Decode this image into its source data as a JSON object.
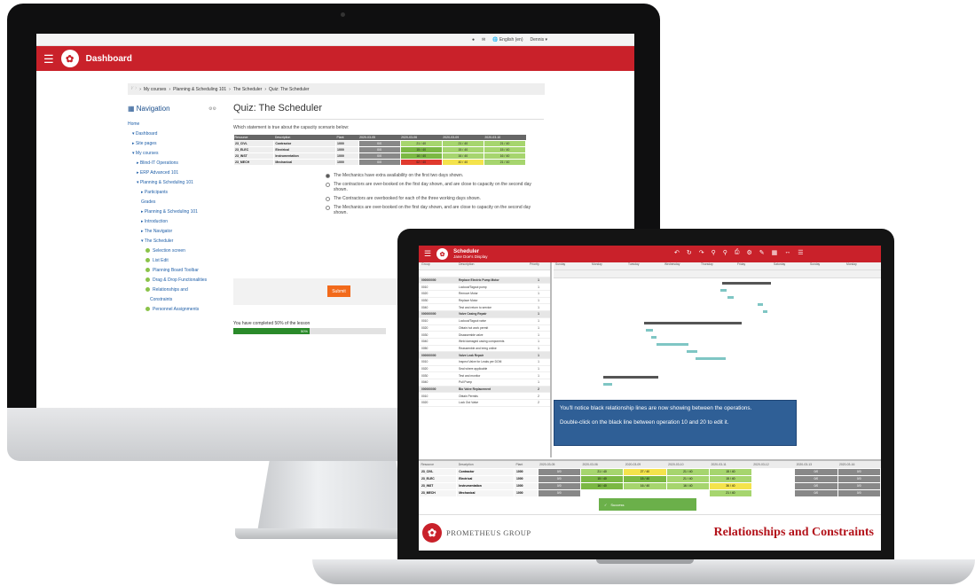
{
  "desktop": {
    "topbar": {
      "language": "English (en)",
      "user": "Dennis"
    },
    "header": {
      "title": "Dashboard"
    },
    "breadcrumb": [
      "My courses",
      "Planning & Scheduling 101",
      "The Scheduler",
      "Quiz: The Scheduler"
    ],
    "nav": {
      "title": "Navigation",
      "items": [
        {
          "label": "Home",
          "indent": 0
        },
        {
          "label": "▾ Dashboard",
          "indent": 1
        },
        {
          "label": "▸ Site pages",
          "indent": 1
        },
        {
          "label": "▾ My courses",
          "indent": 1
        },
        {
          "label": "▸ Blind-IT Operations",
          "indent": 2
        },
        {
          "label": "▸ ERP Advanced 101",
          "indent": 2
        },
        {
          "label": "▾ Planning & Scheduling 101",
          "indent": 2
        },
        {
          "label": "▸ Participants",
          "indent": 3
        },
        {
          "label": "Grades",
          "indent": 3
        },
        {
          "label": "▸ Planning & Scheduling 101",
          "indent": 3
        },
        {
          "label": "▸ Introduction",
          "indent": 3
        },
        {
          "label": "▸ The Navigator",
          "indent": 3
        },
        {
          "label": "▾ The Scheduler",
          "indent": 3
        },
        {
          "label": "Selection screen",
          "indent": 4,
          "dot": true
        },
        {
          "label": "List Edit",
          "indent": 4,
          "dot": true
        },
        {
          "label": "Planning Board Toolbar",
          "indent": 4,
          "dot": true
        },
        {
          "label": "Drag & Drop Functionalities",
          "indent": 4,
          "dot": true
        },
        {
          "label": "Relationships and",
          "indent": 4,
          "dot": true
        },
        {
          "label": "Constraints",
          "indent": 5
        },
        {
          "label": "Personnel Assignments",
          "indent": 4,
          "dot": true
        }
      ]
    },
    "quiz": {
      "title": "Quiz: The Scheduler",
      "question": "Which statement is true about the capacity scenario below:",
      "table_headers": [
        "Resource",
        "Description",
        "Plant",
        "2020-03-05",
        "2020-03-06",
        "2020-03-09",
        "2020-03-10"
      ],
      "table_rows": [
        {
          "res": "23_CIVL",
          "desc": "Contractor",
          "plant": "1000",
          "cells": [
            [
              "0/0",
              "grey"
            ],
            [
              "21 / 40",
              "green"
            ],
            [
              "21 / 40",
              "green"
            ],
            [
              "21 / 40",
              "green"
            ]
          ]
        },
        {
          "res": "23_ELEC",
          "desc": "Electrical",
          "plant": "1000",
          "cells": [
            [
              "0/0",
              "grey"
            ],
            [
              "15 / 40",
              "dkgreen"
            ],
            [
              "15 / 40",
              "green"
            ],
            [
              "15 / 40",
              "green"
            ]
          ]
        },
        {
          "res": "23_INST",
          "desc": "Instrumentation",
          "plant": "1000",
          "cells": [
            [
              "0/0",
              "grey"
            ],
            [
              "16 / 40",
              "dkgreen"
            ],
            [
              "16 / 40",
              "green"
            ],
            [
              "16 / 40",
              "green"
            ]
          ]
        },
        {
          "res": "23_MECH",
          "desc": "Mechanical",
          "plant": "1000",
          "cells": [
            [
              "0/0",
              "grey"
            ],
            [
              "62 / 40",
              "red"
            ],
            [
              "40 / 40",
              "yellow"
            ],
            [
              "21 / 40",
              "green"
            ]
          ]
        }
      ],
      "answers": [
        {
          "text": "The Mechanics have extra availability on the first two days shown.",
          "selected": true
        },
        {
          "text": "The contractors are over-booked on the first day shown, and are close to capacity on the second day shown.",
          "selected": false
        },
        {
          "text": "The Contractors are overbooked for each of the three working days shown.",
          "selected": false
        },
        {
          "text": "The Mechanics are over-booked on the first day shown, and are close to capacity on the second day shown.",
          "selected": false
        }
      ],
      "submit_label": "Submit",
      "completion_text": "You have completed 50% of the lesson",
      "progress_label": "50%",
      "progress_fraction": 0.5
    }
  },
  "laptop": {
    "header": {
      "title": "Scheduler",
      "subtitle": "Jane Doe's Display"
    },
    "left_headers": [
      "Group",
      "Description",
      "Priority"
    ],
    "rows": [
      {
        "c1": "",
        "c2": "",
        "c3": "",
        "grp": false
      },
      {
        "c1": "000000000",
        "c2": "Replace Electric Pump Motor",
        "c3": "1",
        "grp": true
      },
      {
        "c1": "0010",
        "c2": "Lockout/Tagout pump",
        "c3": "1",
        "grp": false
      },
      {
        "c1": "0020",
        "c2": "Remove Motor",
        "c3": "1",
        "grp": false
      },
      {
        "c1": "0030",
        "c2": "Replace Motor",
        "c3": "1",
        "grp": false
      },
      {
        "c1": "0040",
        "c2": "Test and return to service",
        "c3": "1",
        "grp": false
      },
      {
        "c1": "000000000",
        "c2": "Valve Casing Repair",
        "c3": "1",
        "grp": true
      },
      {
        "c1": "0010",
        "c2": "Lockout/Tagout valve",
        "c3": "1",
        "grp": false
      },
      {
        "c1": "0020",
        "c2": "Obtain hot work permit",
        "c3": "1",
        "grp": false
      },
      {
        "c1": "0030",
        "c2": "Disassemble valve",
        "c3": "1",
        "grp": false
      },
      {
        "c1": "0040",
        "c2": "Weld damaged casing components",
        "c3": "1",
        "grp": false
      },
      {
        "c1": "0050",
        "c2": "Reassemble and bring online",
        "c3": "1",
        "grp": false
      },
      {
        "c1": "000000000",
        "c2": "Valve Leak Repair",
        "c3": "1",
        "grp": true
      },
      {
        "c1": "0010",
        "c2": "Inspect Valve for Leaks per DOM",
        "c3": "1",
        "grp": false
      },
      {
        "c1": "0020",
        "c2": "Seal where applicable",
        "c3": "1",
        "grp": false
      },
      {
        "c1": "0030",
        "c2": "Test and monitor",
        "c3": "1",
        "grp": false
      },
      {
        "c1": "0040",
        "c2": "Pull Pump",
        "c3": "1",
        "grp": false
      },
      {
        "c1": "000000000",
        "c2": "Bio Valve Replacement",
        "c3": "2",
        "grp": true
      },
      {
        "c1": "0010",
        "c2": "Obtain Permits",
        "c3": "2",
        "grp": false
      },
      {
        "c1": "0020",
        "c2": "Lock Out Valve",
        "c3": "2",
        "grp": false
      }
    ],
    "days": [
      "Sunday",
      "Monday",
      "Tuesday",
      "Wednesday",
      "Thursday",
      "Friday",
      "Saturday",
      "Sunday",
      "Monday"
    ],
    "tooltip": {
      "line1": "You'll notice black relationship lines are now showing between the operations.",
      "line2": "Double-click on the black line between operation 10 and 20 to edit it."
    },
    "bottom_headers": [
      "Resource",
      "Description",
      "Plant",
      "2020-03-05",
      "2020-03-06",
      "2020-03-09",
      "2020-03-10",
      "2020-03-11",
      "2020-03-12",
      "2020-03-13",
      "2020-03-16"
    ],
    "bottom_rows": [
      {
        "res": "23_CIVL",
        "desc": "Contractor",
        "plant": "1000",
        "cells": [
          [
            "0/0",
            "grey"
          ],
          [
            "21 / 40",
            "green"
          ],
          [
            "27 / 40",
            "yellow"
          ],
          [
            "21 / 40",
            "green"
          ],
          [
            "15 / 40",
            "green"
          ],
          [
            "",
            "white"
          ],
          [
            "0/0",
            "grey"
          ],
          [
            "0/0",
            "grey"
          ]
        ]
      },
      {
        "res": "23_ELEC",
        "desc": "Electrical",
        "plant": "1000",
        "cells": [
          [
            "0/0",
            "grey"
          ],
          [
            "15 / 40",
            "dkgreen"
          ],
          [
            "15 / 40",
            "dkgreen"
          ],
          [
            "21 / 40",
            "green"
          ],
          [
            "15 / 40",
            "green"
          ],
          [
            "",
            "white"
          ],
          [
            "0/0",
            "grey"
          ],
          [
            "0/0",
            "grey"
          ]
        ]
      },
      {
        "res": "23_INST",
        "desc": "Instrumentation",
        "plant": "1000",
        "cells": [
          [
            "0/0",
            "grey"
          ],
          [
            "16 / 40",
            "dkgreen"
          ],
          [
            "16 / 40",
            "green"
          ],
          [
            "16 / 40",
            "green"
          ],
          [
            "36 / 40",
            "yellow"
          ],
          [
            "",
            "white"
          ],
          [
            "0/0",
            "grey"
          ],
          [
            "0/0",
            "grey"
          ]
        ]
      },
      {
        "res": "23_MECH",
        "desc": "Mechanical",
        "plant": "1000",
        "cells": [
          [
            "0/0",
            "grey"
          ],
          [
            "",
            "white"
          ],
          [
            "",
            "white"
          ],
          [
            "",
            "white"
          ],
          [
            "21 / 40",
            "green"
          ],
          [
            "",
            "white"
          ],
          [
            "0/0",
            "grey"
          ],
          [
            "0/0",
            "grey"
          ]
        ]
      }
    ],
    "success_text": "Success",
    "footer": {
      "brand": "PROMETHEUS GROUP",
      "title": "Relationships and Constraints"
    }
  }
}
